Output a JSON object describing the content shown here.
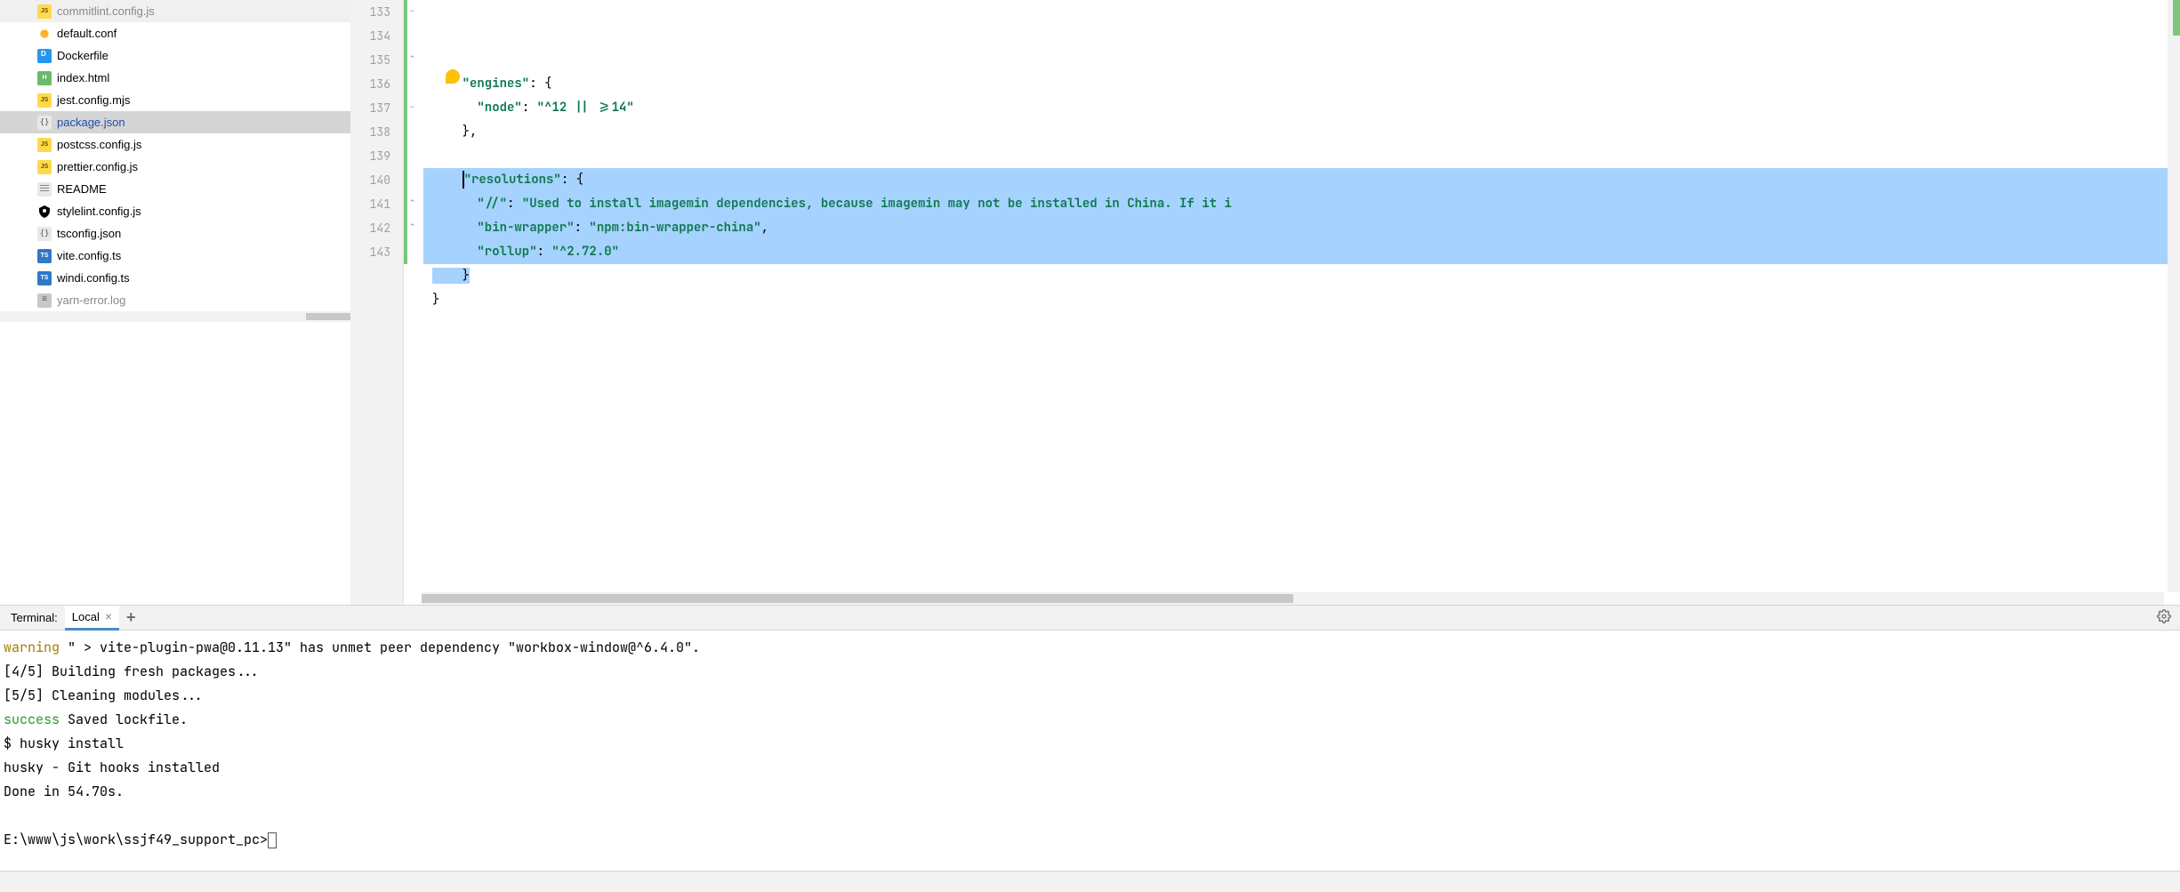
{
  "sidebar": {
    "files": [
      {
        "name": "commitlint.config.js",
        "iconType": "js",
        "iconLabel": "JS",
        "selected": false,
        "dimmed": true
      },
      {
        "name": "default.conf",
        "iconType": "conf",
        "iconLabel": "",
        "selected": false,
        "dimmed": false
      },
      {
        "name": "Dockerfile",
        "iconType": "docker",
        "iconLabel": "",
        "selected": false,
        "dimmed": false
      },
      {
        "name": "index.html",
        "iconType": "html",
        "iconLabel": "H",
        "selected": false,
        "dimmed": false
      },
      {
        "name": "jest.config.mjs",
        "iconType": "js",
        "iconLabel": "JS",
        "selected": false,
        "dimmed": false
      },
      {
        "name": "package.json",
        "iconType": "json",
        "iconLabel": "{}",
        "selected": true,
        "dimmed": false
      },
      {
        "name": "postcss.config.js",
        "iconType": "js",
        "iconLabel": "JS",
        "selected": false,
        "dimmed": false
      },
      {
        "name": "prettier.config.js",
        "iconType": "js",
        "iconLabel": "JS",
        "selected": false,
        "dimmed": false
      },
      {
        "name": "README",
        "iconType": "txt",
        "iconLabel": "",
        "selected": false,
        "dimmed": false
      },
      {
        "name": "stylelint.config.js",
        "iconType": "stylelint",
        "iconLabel": "",
        "selected": false,
        "dimmed": false
      },
      {
        "name": "tsconfig.json",
        "iconType": "json",
        "iconLabel": "{}",
        "selected": false,
        "dimmed": false
      },
      {
        "name": "vite.config.ts",
        "iconType": "ts",
        "iconLabel": "TS",
        "selected": false,
        "dimmed": false
      },
      {
        "name": "windi.config.ts",
        "iconType": "ts",
        "iconLabel": "TS",
        "selected": false,
        "dimmed": false
      },
      {
        "name": "yarn-error.log",
        "iconType": "equals",
        "iconLabel": "≡",
        "selected": false,
        "dimmed": true
      }
    ]
  },
  "editor": {
    "firstLine": 133,
    "lines": [
      {
        "num": 133,
        "selected": false,
        "indent": "    ",
        "tokens": [
          {
            "t": "key",
            "v": "\"engines\""
          },
          {
            "t": "punc",
            "v": ": {"
          }
        ]
      },
      {
        "num": 134,
        "selected": false,
        "indent": "      ",
        "tokens": [
          {
            "t": "key",
            "v": "\"node\""
          },
          {
            "t": "punc",
            "v": ": "
          },
          {
            "t": "str",
            "v": "\"^12 || >=14\""
          }
        ]
      },
      {
        "num": 135,
        "selected": false,
        "indent": "    ",
        "tokens": [
          {
            "t": "punc",
            "v": "},"
          }
        ]
      },
      {
        "num": 136,
        "selected": false,
        "indent": "",
        "tokens": []
      },
      {
        "num": 137,
        "selected": true,
        "indent": "    ",
        "cursor": true,
        "tokens": [
          {
            "t": "key",
            "v": "\"resolutions\""
          },
          {
            "t": "punc",
            "v": ": {"
          }
        ]
      },
      {
        "num": 138,
        "selected": true,
        "indent": "      ",
        "tokens": [
          {
            "t": "key",
            "v": "\"//\""
          },
          {
            "t": "punc",
            "v": ": "
          },
          {
            "t": "str",
            "v": "\"Used to install imagemin dependencies, because imagemin may not be installed in China. If it i"
          }
        ]
      },
      {
        "num": 139,
        "selected": true,
        "indent": "      ",
        "tokens": [
          {
            "t": "key",
            "v": "\"bin-wrapper\""
          },
          {
            "t": "punc",
            "v": ": "
          },
          {
            "t": "str",
            "v": "\"npm:bin-wrapper-china\""
          },
          {
            "t": "punc",
            "v": ","
          }
        ]
      },
      {
        "num": 140,
        "selected": true,
        "indent": "      ",
        "tokens": [
          {
            "t": "key",
            "v": "\"rollup\""
          },
          {
            "t": "punc",
            "v": ": "
          },
          {
            "t": "str",
            "v": "\"^2.72.0\""
          }
        ]
      },
      {
        "num": 141,
        "selected": false,
        "partialSel": true,
        "indent": "    ",
        "tokens": [
          {
            "t": "punc",
            "v": "}"
          }
        ]
      },
      {
        "num": 142,
        "selected": false,
        "indent": "",
        "tokens": [
          {
            "t": "punc",
            "v": "}"
          }
        ]
      },
      {
        "num": 143,
        "selected": false,
        "indent": "",
        "tokens": []
      }
    ]
  },
  "terminal": {
    "title": "Terminal:",
    "tabLabel": "Local",
    "lines": [
      {
        "segments": [
          {
            "cls": "t-warn",
            "v": "warning"
          },
          {
            "cls": "",
            "v": " \" > vite-plugin-pwa@0.11.13\" has unmet peer dependency \"workbox-window@^6.4.0\"."
          }
        ]
      },
      {
        "segments": [
          {
            "cls": "",
            "v": "[4/5] Building fresh packages..."
          }
        ]
      },
      {
        "segments": [
          {
            "cls": "",
            "v": "[5/5] Cleaning modules..."
          }
        ]
      },
      {
        "segments": [
          {
            "cls": "t-succ",
            "v": "success"
          },
          {
            "cls": "",
            "v": " Saved lockfile."
          }
        ]
      },
      {
        "segments": [
          {
            "cls": "",
            "v": "$ husky install"
          }
        ]
      },
      {
        "segments": [
          {
            "cls": "",
            "v": "husky - Git hooks installed"
          }
        ]
      },
      {
        "segments": [
          {
            "cls": "",
            "v": "Done in 54.70s."
          }
        ]
      },
      {
        "segments": [
          {
            "cls": "",
            "v": ""
          }
        ]
      },
      {
        "prompt": true,
        "segments": [
          {
            "cls": "",
            "v": "E:\\www\\js\\work\\ssjf49_support_pc>"
          }
        ]
      }
    ]
  }
}
